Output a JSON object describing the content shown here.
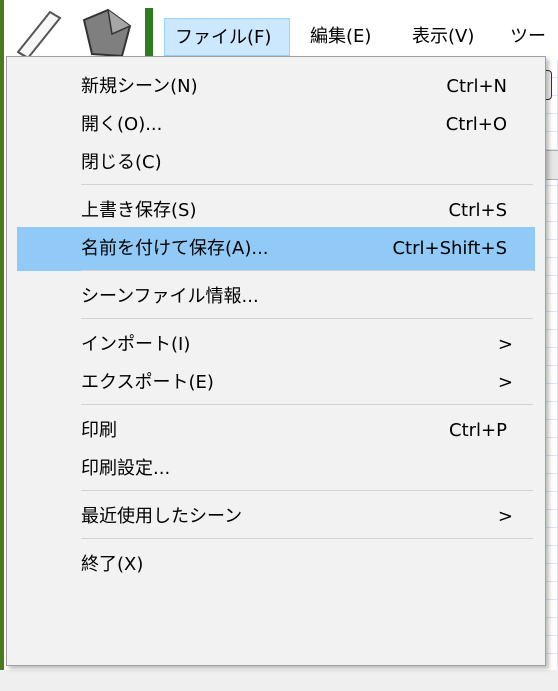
{
  "menubar": {
    "items": [
      {
        "label": "ファイル(F)"
      },
      {
        "label": "編集(E)"
      },
      {
        "label": "表示(V)"
      },
      {
        "label": "ツー"
      }
    ]
  },
  "file_menu": {
    "groups": [
      [
        {
          "label": "新規シーン(N)",
          "shortcut": "Ctrl+N"
        },
        {
          "label": "開く(O)...",
          "shortcut": "Ctrl+O"
        },
        {
          "label": "閉じる(C)",
          "shortcut": ""
        }
      ],
      [
        {
          "label": "上書き保存(S)",
          "shortcut": "Ctrl+S"
        },
        {
          "label": "名前を付けて保存(A)...",
          "shortcut": "Ctrl+Shift+S",
          "highlighted": true
        }
      ],
      [
        {
          "label": "シーンファイル情報...",
          "shortcut": ""
        }
      ],
      [
        {
          "label": "インポート(I)",
          "shortcut": "",
          "submenu_arrow": ">"
        },
        {
          "label": "エクスポート(E)",
          "shortcut": "",
          "submenu_arrow": ">"
        }
      ],
      [
        {
          "label": "印刷",
          "shortcut": "Ctrl+P"
        },
        {
          "label": "印刷設定...",
          "shortcut": ""
        }
      ],
      [
        {
          "label": "最近使用したシーン",
          "shortcut": "",
          "submenu_arrow": ">"
        }
      ],
      [
        {
          "label": "終了(X)",
          "shortcut": ""
        }
      ]
    ]
  },
  "colors": {
    "menu_bg": "#f2f2f2",
    "highlight": "#91c9f7",
    "active_menubar": "#cce8ff",
    "separator": "#d2d2d2",
    "accent_green": "#2f7d20"
  },
  "icons": [
    "pen-tool-icon",
    "brush-tool-icon",
    "submenu-chevron-icon"
  ]
}
